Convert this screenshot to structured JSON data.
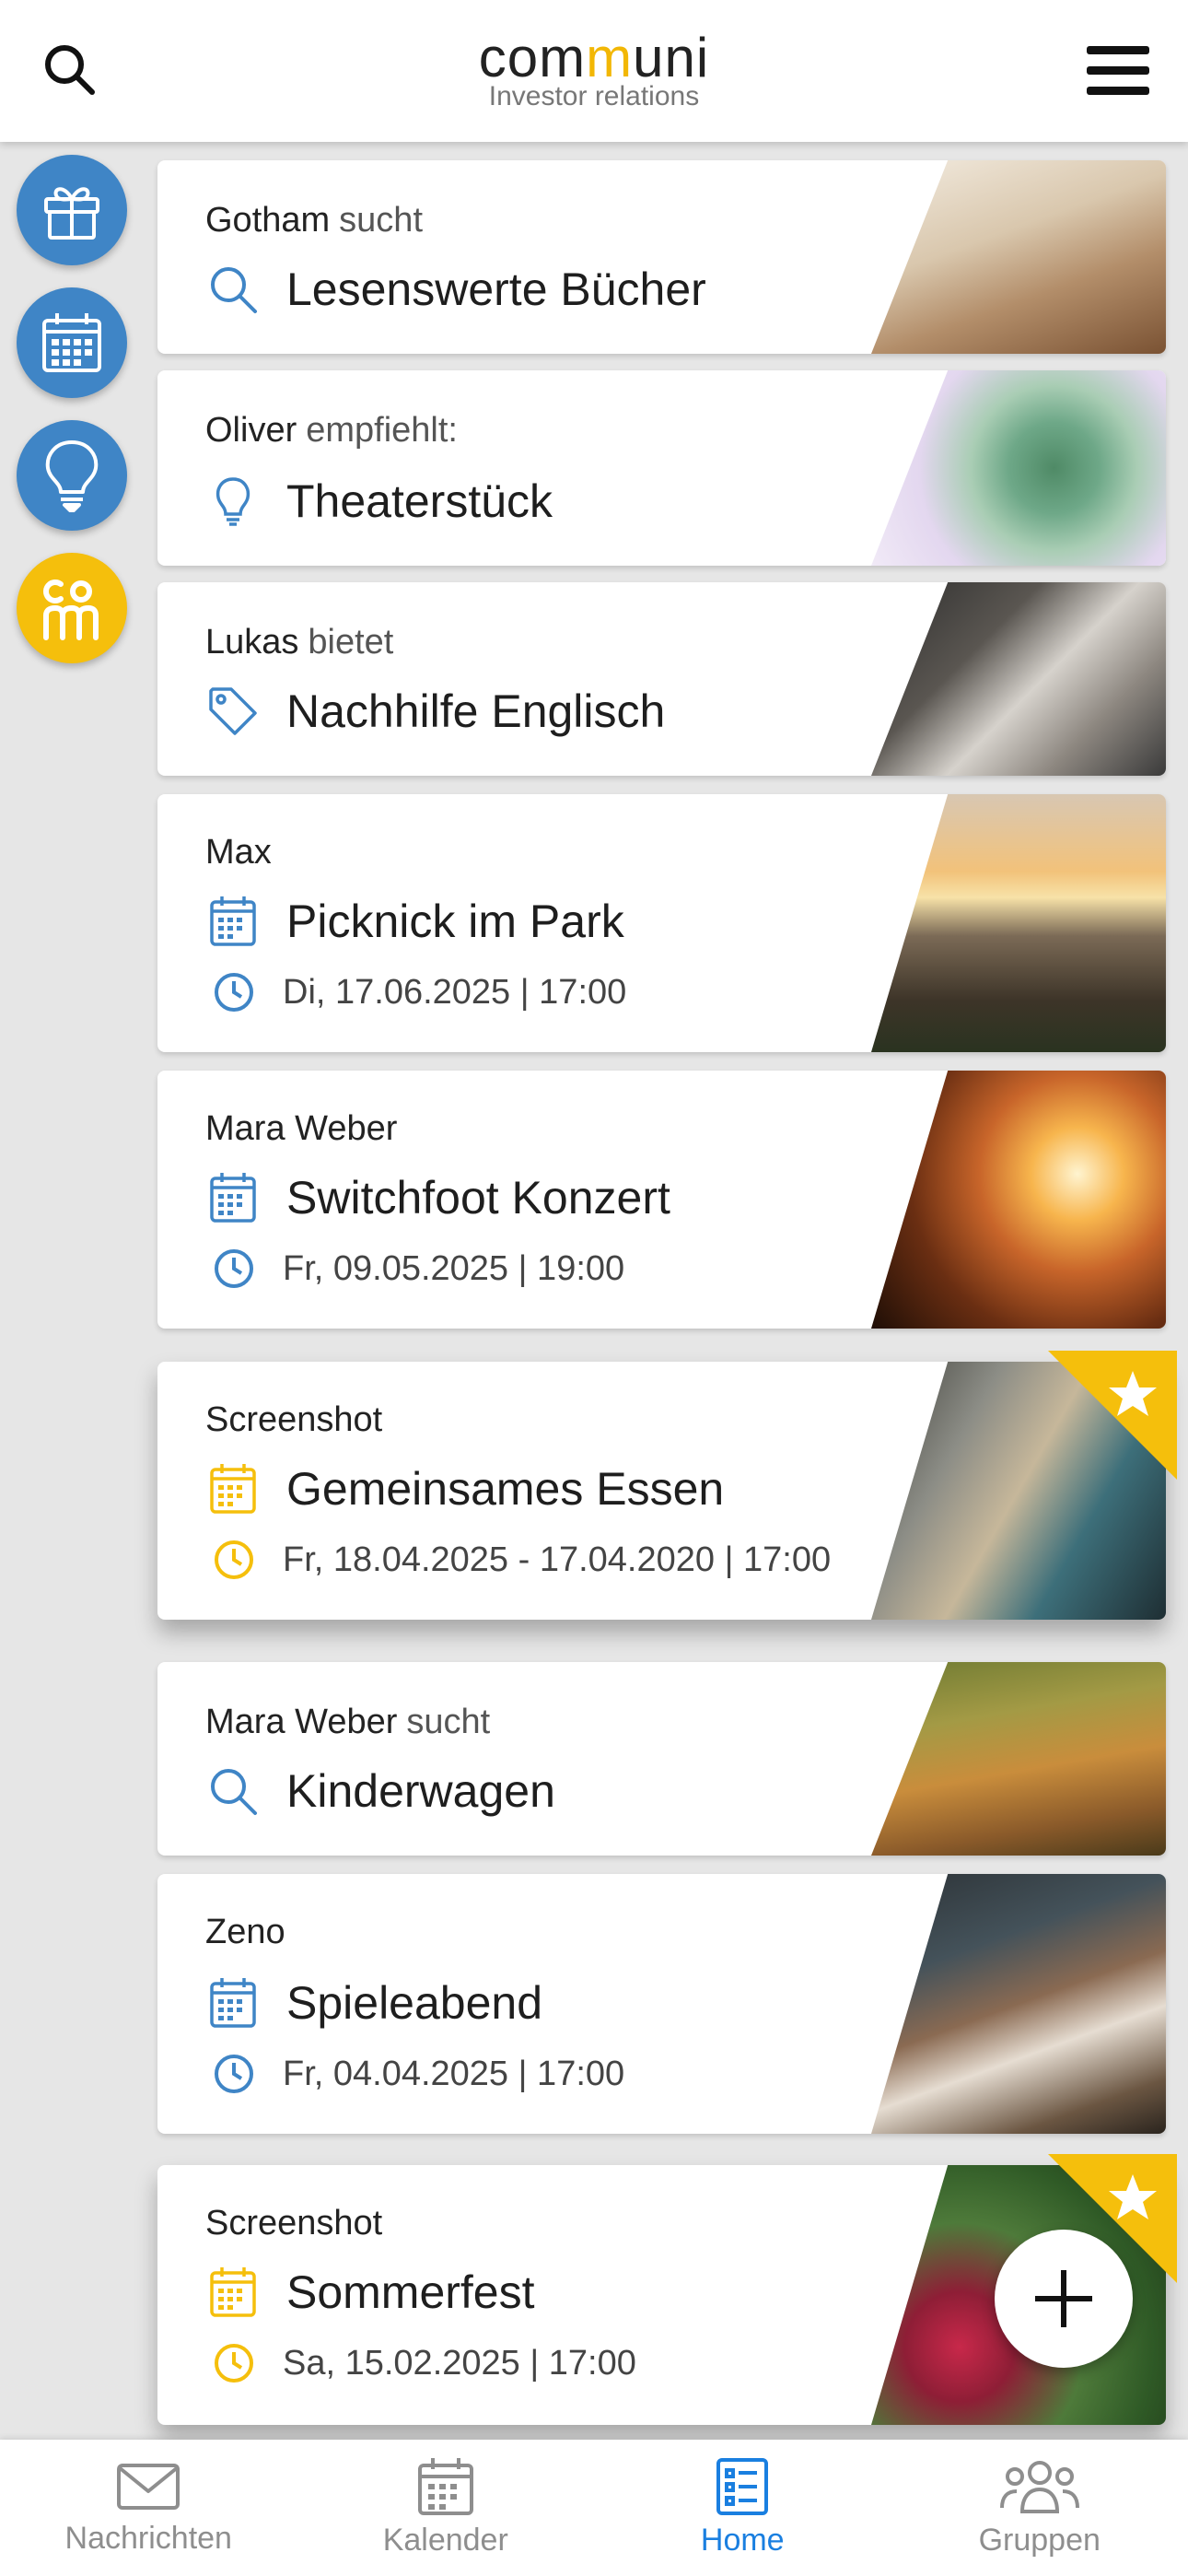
{
  "header": {
    "logo_prefix": "com",
    "logo_mm": "m",
    "logo_suffix": "uni",
    "subtitle": "Investor relations"
  },
  "colors": {
    "accent_blue": "#3f85c6",
    "accent_yellow": "#f5bf0c",
    "active_tab": "#1a7fe0"
  },
  "sidebar": {
    "items": [
      {
        "icon": "gift-icon"
      },
      {
        "icon": "calendar-icon"
      },
      {
        "icon": "lightbulb-icon"
      },
      {
        "icon": "communi-logo-icon"
      }
    ]
  },
  "cards": [
    {
      "author": "Gotham",
      "verb": "sucht",
      "title": "Lesenswerte Bücher",
      "icon": "search-icon"
    },
    {
      "author": "Oliver",
      "verb": "empfiehlt:",
      "title": "Theaterstück",
      "icon": "lightbulb-icon"
    },
    {
      "author": "Lukas",
      "verb": "bietet",
      "title": "Nachhilfe Englisch",
      "icon": "tag-icon"
    },
    {
      "author": "Max",
      "title": "Picknick im Park",
      "date": "Di, 17.06.2025 | 17:00",
      "icon": "calendar-icon"
    },
    {
      "author": "Mara Weber",
      "title": "Switchfoot Konzert",
      "date": "Fr, 09.05.2025 | 19:00",
      "icon": "calendar-icon"
    },
    {
      "author": "Screenshot",
      "title": "Gemeinsames Essen",
      "date": "Fr, 18.04.2025 - 17.04.2020 | 17:00",
      "icon": "calendar-icon",
      "starred": true
    },
    {
      "author": "Mara Weber",
      "verb": "sucht",
      "title": "Kinderwagen",
      "icon": "search-icon"
    },
    {
      "author": "Zeno",
      "title": "Spieleabend",
      "date": "Fr, 04.04.2025 | 17:00",
      "icon": "calendar-icon"
    },
    {
      "author": "Screenshot",
      "title": "Sommerfest",
      "date": "Sa, 15.02.2025 | 17:00",
      "icon": "calendar-icon",
      "starred": true
    }
  ],
  "tabs": [
    {
      "label": "Nachrichten",
      "icon": "mail-icon"
    },
    {
      "label": "Kalender",
      "icon": "calendar-icon"
    },
    {
      "label": "Home",
      "icon": "list-icon",
      "active": true
    },
    {
      "label": "Gruppen",
      "icon": "group-icon"
    }
  ]
}
